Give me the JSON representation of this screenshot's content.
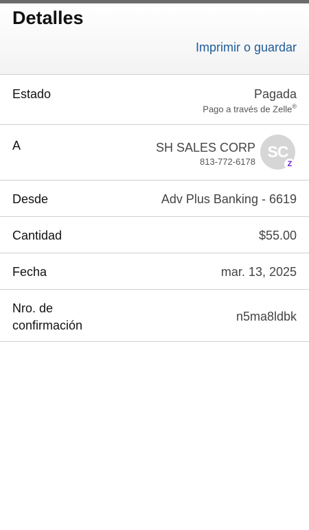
{
  "header": {
    "title": "Detalles",
    "print_label": "Imprimir o guardar"
  },
  "rows": {
    "estado": {
      "label": "Estado",
      "value": "Pagada",
      "sub": "Pago a través de Zelle",
      "sub_mark": "®"
    },
    "a": {
      "label": "A",
      "name": "SH SALES CORP",
      "phone": "813-772-6178",
      "avatar_initials": "SC",
      "badge_icon": "zelle-icon",
      "badge_glyph": "Z"
    },
    "desde": {
      "label": "Desde",
      "value": "Adv Plus Banking - 6619"
    },
    "cantidad": {
      "label": "Cantidad",
      "value": "$55.00"
    },
    "fecha": {
      "label": "Fecha",
      "value": "mar. 13, 2025"
    },
    "confirmacion": {
      "label_line1": "Nro. de",
      "label_line2": "confirmación",
      "value": "n5ma8ldbk"
    }
  },
  "colors": {
    "link": "#1f5c99",
    "zelle": "#6d1ed4",
    "avatar_bg": "#d6d6d6"
  }
}
